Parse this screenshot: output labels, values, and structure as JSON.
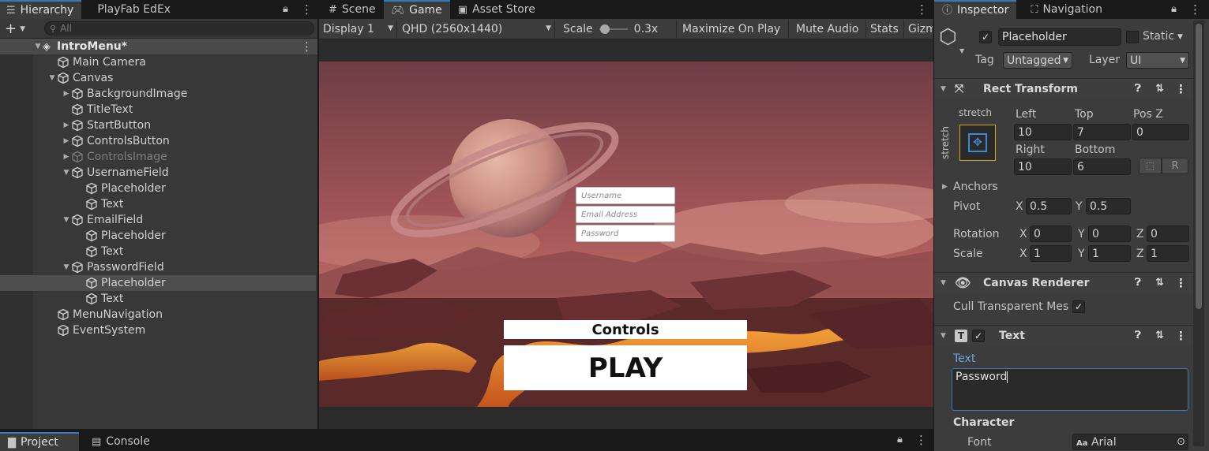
{
  "hierarchy": {
    "tabs": [
      "Hierarchy",
      "PlayFab EdEx"
    ],
    "search_placeholder": "All",
    "scene_name": "IntroMenu*",
    "items": [
      {
        "label": "Main Camera"
      },
      {
        "label": "Canvas"
      },
      {
        "label": "BackgroundImage"
      },
      {
        "label": "TitleText"
      },
      {
        "label": "StartButton"
      },
      {
        "label": "ControlsButton"
      },
      {
        "label": "ControlsImage"
      },
      {
        "label": "UsernameField"
      },
      {
        "label": "Placeholder"
      },
      {
        "label": "Text"
      },
      {
        "label": "EmailField"
      },
      {
        "label": "Placeholder"
      },
      {
        "label": "Text"
      },
      {
        "label": "PasswordField"
      },
      {
        "label": "Placeholder"
      },
      {
        "label": "Text"
      },
      {
        "label": "MenuNavigation"
      },
      {
        "label": "EventSystem"
      }
    ]
  },
  "game_view": {
    "tabs": [
      "Scene",
      "Game",
      "Asset Store"
    ],
    "display": "Display 1",
    "resolution": "QHD (2560x1440)",
    "scale_label": "Scale",
    "scale_value": "0.3x",
    "scale_fraction": 0.05,
    "maximize": "Maximize On Play",
    "mute": "Mute Audio",
    "stats": "Stats",
    "gizmos": "Gizmos",
    "username_placeholder": "Username",
    "email_placeholder": "Email Address",
    "password_placeholder": "Password",
    "controls_label": "Controls",
    "play_label": "PLAY"
  },
  "inspector": {
    "tabs": [
      "Inspector",
      "Navigation"
    ],
    "object_name": "Placeholder",
    "static_label": "Static",
    "tag_label": "Tag",
    "tag_value": "Untagged",
    "layer_label": "Layer",
    "layer_value": "UI",
    "rect_transform": {
      "title": "Rect Transform",
      "anchor_h": "stretch",
      "anchor_v": "stretch",
      "left_label": "Left",
      "left": "10",
      "top_label": "Top",
      "top": "7",
      "posz_label": "Pos Z",
      "posz": "0",
      "right_label": "Right",
      "right": "10",
      "bottom_label": "Bottom",
      "bottom": "6",
      "r_label": "R",
      "anchors_label": "Anchors",
      "pivot_label": "Pivot",
      "pivot_x": "0.5",
      "pivot_y": "0.5",
      "rotation_label": "Rotation",
      "rot_x": "0",
      "rot_y": "0",
      "rot_z": "0",
      "scale_label": "Scale",
      "scale_x": "1",
      "scale_y": "1",
      "scale_z": "1",
      "x": "X",
      "y": "Y",
      "z": "Z"
    },
    "canvas_renderer": {
      "title": "Canvas Renderer",
      "cull_label": "Cull Transparent Mes"
    },
    "text_component": {
      "title": "Text",
      "text_label": "Text",
      "text_value": "Password",
      "character_label": "Character",
      "font_label": "Font",
      "font_value": "Arial"
    }
  },
  "bottom": {
    "tabs": [
      "Project",
      "Console"
    ]
  },
  "colors": {
    "accent": "#3a79bb",
    "panel": "#383838",
    "field": "#2a2a2a"
  }
}
